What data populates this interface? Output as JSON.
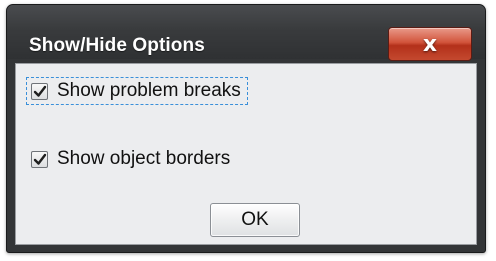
{
  "dialog": {
    "title": "Show/Hide Options",
    "close_button": {
      "label": "x",
      "icon": "close-icon",
      "color": "#c4492f"
    }
  },
  "options": [
    {
      "label": "Show problem breaks",
      "checked": true,
      "focused": true
    },
    {
      "label": "Show object borders",
      "checked": true,
      "focused": false
    }
  ],
  "buttons": {
    "ok_label": "OK"
  },
  "colors": {
    "titlebar": "#393b3d",
    "content_background": "#ecedef",
    "focus_outline": "#3a8fd9"
  }
}
